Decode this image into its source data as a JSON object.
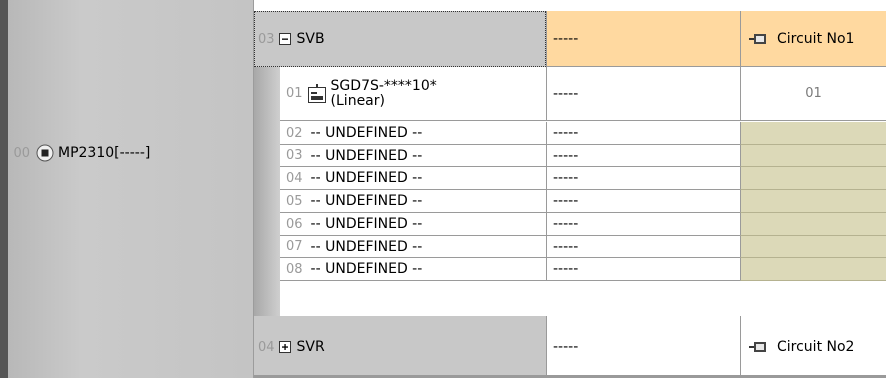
{
  "rack": {
    "cpu": {
      "slot": "00",
      "name": "MP2310[-----]"
    }
  },
  "modules": [
    {
      "slot": "03",
      "name": "SVB",
      "expanded": true,
      "detail": "-----",
      "circuit": "Circuit No1",
      "axes": [
        {
          "num": "01",
          "name_line1": "SGD7S-****10*",
          "name_line2": "(Linear)",
          "detail": "-----",
          "value": "01"
        },
        {
          "num": "02",
          "name": "-- UNDEFINED --",
          "detail": "-----"
        },
        {
          "num": "03",
          "name": "-- UNDEFINED --",
          "detail": "-----"
        },
        {
          "num": "04",
          "name": "-- UNDEFINED --",
          "detail": "-----"
        },
        {
          "num": "05",
          "name": "-- UNDEFINED --",
          "detail": "-----"
        },
        {
          "num": "06",
          "name": "-- UNDEFINED --",
          "detail": "-----"
        },
        {
          "num": "07",
          "name": "-- UNDEFINED --",
          "detail": "-----"
        },
        {
          "num": "08",
          "name": "-- UNDEFINED --",
          "detail": "-----"
        }
      ]
    },
    {
      "slot": "04",
      "name": "SVR",
      "expanded": false,
      "detail": "-----",
      "circuit": "Circuit No2"
    }
  ],
  "colors": {
    "module_row_bg": "#c8c8c8",
    "circuit_highlight_bg": "#ffd9a0",
    "empty_cell_bg": "#dcd9b8",
    "left_panel_bg": "#c4c4c4"
  },
  "icons": {
    "expand": "collapse-minus-icon",
    "collapsed": "expand-plus-icon",
    "servo": "servo-drive-icon",
    "circuit": "circuit-connector-icon",
    "cpu": "cpu-module-icon"
  }
}
